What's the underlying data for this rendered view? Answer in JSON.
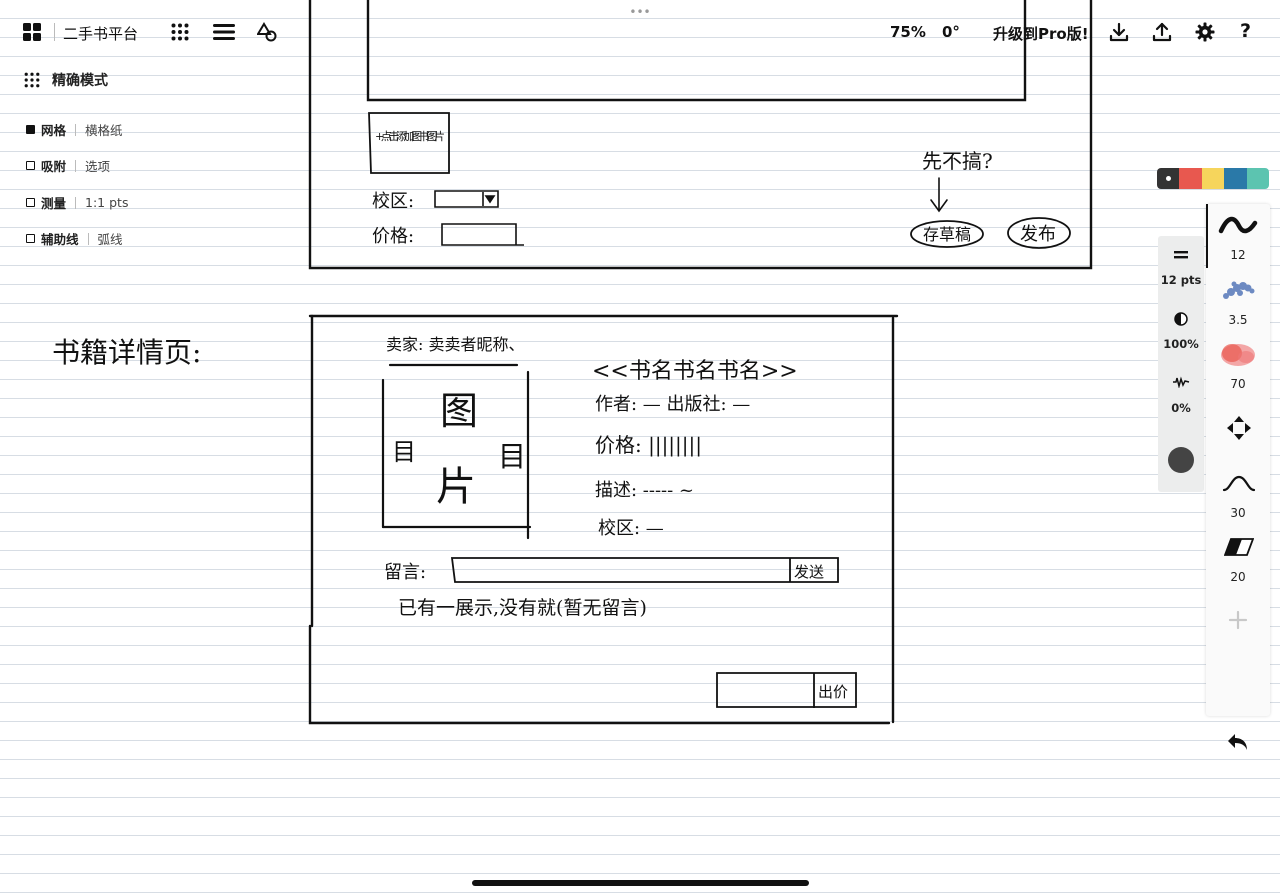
{
  "topbar": {
    "app_title": "二手书平台",
    "zoom": "75%",
    "rotation": "0°",
    "upgrade_label": "升级到Pro版!",
    "icons": [
      "apps-grid-icon",
      "dots-grid-icon",
      "lines-menu-icon",
      "shapes-icon",
      "download-icon",
      "share-icon",
      "settings-gear-icon",
      "help-icon"
    ],
    "help_label": "?"
  },
  "canvas": {
    "drag_handle": "•••"
  },
  "mode": {
    "label": "精确模式"
  },
  "options": [
    {
      "label": "网格",
      "value": "横格纸",
      "checked": true
    },
    {
      "label": "吸附",
      "value": "选项",
      "checked": false
    },
    {
      "label": "测量",
      "value": "1:1 pts",
      "checked": false
    },
    {
      "label": "辅助线",
      "value": "弧线",
      "checked": false
    }
  ],
  "palette": {
    "colors": [
      "#333333",
      "#e8584f",
      "#f6d55c",
      "#2a79a8",
      "#5cc4b0"
    ]
  },
  "properties": {
    "width_value": "12 pts",
    "opacity_value": "100%",
    "pressure_value": "0%",
    "current_color": "#444444"
  },
  "tools": [
    {
      "name": "pen",
      "value": "12"
    },
    {
      "name": "pencil",
      "value": "3.5"
    },
    {
      "name": "brush",
      "value": "70"
    },
    {
      "name": "move"
    },
    {
      "name": "curve",
      "value": "30"
    },
    {
      "name": "eraser",
      "value": "20"
    },
    {
      "name": "add"
    }
  ],
  "sketch": {
    "upper_frame": {
      "image_box": "+点击添加图书图片",
      "campus_label": "校区:",
      "price_label": "价格:",
      "draft_note": "先不搞?",
      "draft_button": "存草稿",
      "publish_button": "发布"
    },
    "detail_page": {
      "title": "书籍详情页:",
      "seller": "卖家: 卖卖者昵称、",
      "image_chars": [
        "图",
        "目",
        "目",
        "片"
      ],
      "book_name": "<<书名书名书名>>",
      "author": "作者: —  出版社: —",
      "price": "价格: ||||||||",
      "description": "描述: ----- ~",
      "campus": "校区: —",
      "comment_label": "留言:",
      "send_button": "发送",
      "existing_comment": "已有一展示,没有就(暂无留言)",
      "buy_button": "出价"
    }
  }
}
